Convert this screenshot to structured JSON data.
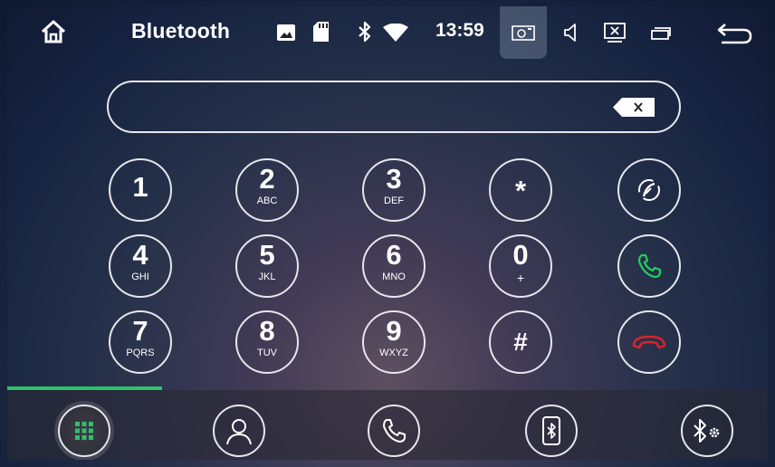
{
  "statusbar": {
    "title": "Bluetooth",
    "time": "13:59",
    "icons": [
      "home-icon",
      "image-icon",
      "sd-card-icon",
      "bluetooth-icon",
      "wifi-icon",
      "camera-icon",
      "volume-icon",
      "screen-icon",
      "window-icon",
      "back-icon"
    ]
  },
  "dialer": {
    "input_value": "",
    "keys": [
      {
        "digit": "1",
        "letters": ""
      },
      {
        "digit": "2",
        "letters": "ABC"
      },
      {
        "digit": "3",
        "letters": "DEF"
      },
      {
        "digit": "*",
        "letters": ""
      },
      {
        "digit": "4",
        "letters": "GHI"
      },
      {
        "digit": "5",
        "letters": "JKL"
      },
      {
        "digit": "6",
        "letters": "MNO"
      },
      {
        "digit": "0",
        "letters": "+"
      },
      {
        "digit": "7",
        "letters": "PQRS"
      },
      {
        "digit": "8",
        "letters": "TUV"
      },
      {
        "digit": "9",
        "letters": "WXYZ"
      },
      {
        "digit": "#",
        "letters": ""
      }
    ],
    "side_buttons": [
      "switch-audio-icon",
      "call-icon",
      "hangup-icon"
    ]
  },
  "bottomnav": {
    "items": [
      "dialpad-icon",
      "contacts-icon",
      "call-log-icon",
      "phone-bluetooth-icon",
      "bluetooth-settings-icon"
    ],
    "active": "dialpad-icon"
  },
  "colors": {
    "accent": "#2fc06a",
    "call_green": "#1fd25a",
    "hangup_red": "#e0202a"
  }
}
